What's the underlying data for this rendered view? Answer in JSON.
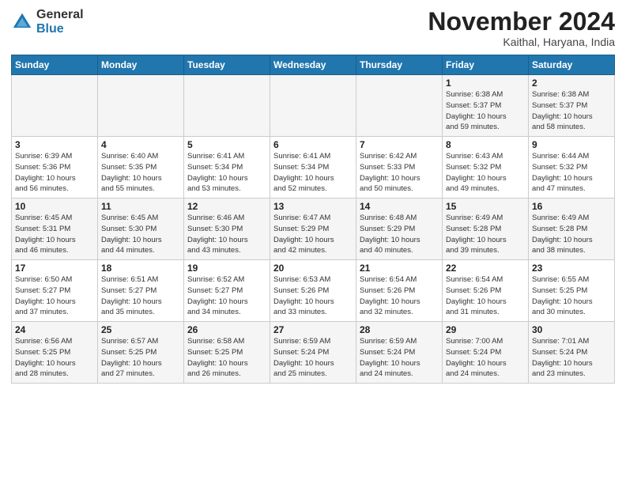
{
  "logo": {
    "line1": "General",
    "line2": "Blue"
  },
  "title": "November 2024",
  "location": "Kaithal, Haryana, India",
  "weekdays": [
    "Sunday",
    "Monday",
    "Tuesday",
    "Wednesday",
    "Thursday",
    "Friday",
    "Saturday"
  ],
  "weeks": [
    [
      {
        "day": "",
        "info": ""
      },
      {
        "day": "",
        "info": ""
      },
      {
        "day": "",
        "info": ""
      },
      {
        "day": "",
        "info": ""
      },
      {
        "day": "",
        "info": ""
      },
      {
        "day": "1",
        "info": "Sunrise: 6:38 AM\nSunset: 5:37 PM\nDaylight: 10 hours\nand 59 minutes."
      },
      {
        "day": "2",
        "info": "Sunrise: 6:38 AM\nSunset: 5:37 PM\nDaylight: 10 hours\nand 58 minutes."
      }
    ],
    [
      {
        "day": "3",
        "info": "Sunrise: 6:39 AM\nSunset: 5:36 PM\nDaylight: 10 hours\nand 56 minutes."
      },
      {
        "day": "4",
        "info": "Sunrise: 6:40 AM\nSunset: 5:35 PM\nDaylight: 10 hours\nand 55 minutes."
      },
      {
        "day": "5",
        "info": "Sunrise: 6:41 AM\nSunset: 5:34 PM\nDaylight: 10 hours\nand 53 minutes."
      },
      {
        "day": "6",
        "info": "Sunrise: 6:41 AM\nSunset: 5:34 PM\nDaylight: 10 hours\nand 52 minutes."
      },
      {
        "day": "7",
        "info": "Sunrise: 6:42 AM\nSunset: 5:33 PM\nDaylight: 10 hours\nand 50 minutes."
      },
      {
        "day": "8",
        "info": "Sunrise: 6:43 AM\nSunset: 5:32 PM\nDaylight: 10 hours\nand 49 minutes."
      },
      {
        "day": "9",
        "info": "Sunrise: 6:44 AM\nSunset: 5:32 PM\nDaylight: 10 hours\nand 47 minutes."
      }
    ],
    [
      {
        "day": "10",
        "info": "Sunrise: 6:45 AM\nSunset: 5:31 PM\nDaylight: 10 hours\nand 46 minutes."
      },
      {
        "day": "11",
        "info": "Sunrise: 6:45 AM\nSunset: 5:30 PM\nDaylight: 10 hours\nand 44 minutes."
      },
      {
        "day": "12",
        "info": "Sunrise: 6:46 AM\nSunset: 5:30 PM\nDaylight: 10 hours\nand 43 minutes."
      },
      {
        "day": "13",
        "info": "Sunrise: 6:47 AM\nSunset: 5:29 PM\nDaylight: 10 hours\nand 42 minutes."
      },
      {
        "day": "14",
        "info": "Sunrise: 6:48 AM\nSunset: 5:29 PM\nDaylight: 10 hours\nand 40 minutes."
      },
      {
        "day": "15",
        "info": "Sunrise: 6:49 AM\nSunset: 5:28 PM\nDaylight: 10 hours\nand 39 minutes."
      },
      {
        "day": "16",
        "info": "Sunrise: 6:49 AM\nSunset: 5:28 PM\nDaylight: 10 hours\nand 38 minutes."
      }
    ],
    [
      {
        "day": "17",
        "info": "Sunrise: 6:50 AM\nSunset: 5:27 PM\nDaylight: 10 hours\nand 37 minutes."
      },
      {
        "day": "18",
        "info": "Sunrise: 6:51 AM\nSunset: 5:27 PM\nDaylight: 10 hours\nand 35 minutes."
      },
      {
        "day": "19",
        "info": "Sunrise: 6:52 AM\nSunset: 5:27 PM\nDaylight: 10 hours\nand 34 minutes."
      },
      {
        "day": "20",
        "info": "Sunrise: 6:53 AM\nSunset: 5:26 PM\nDaylight: 10 hours\nand 33 minutes."
      },
      {
        "day": "21",
        "info": "Sunrise: 6:54 AM\nSunset: 5:26 PM\nDaylight: 10 hours\nand 32 minutes."
      },
      {
        "day": "22",
        "info": "Sunrise: 6:54 AM\nSunset: 5:26 PM\nDaylight: 10 hours\nand 31 minutes."
      },
      {
        "day": "23",
        "info": "Sunrise: 6:55 AM\nSunset: 5:25 PM\nDaylight: 10 hours\nand 30 minutes."
      }
    ],
    [
      {
        "day": "24",
        "info": "Sunrise: 6:56 AM\nSunset: 5:25 PM\nDaylight: 10 hours\nand 28 minutes."
      },
      {
        "day": "25",
        "info": "Sunrise: 6:57 AM\nSunset: 5:25 PM\nDaylight: 10 hours\nand 27 minutes."
      },
      {
        "day": "26",
        "info": "Sunrise: 6:58 AM\nSunset: 5:25 PM\nDaylight: 10 hours\nand 26 minutes."
      },
      {
        "day": "27",
        "info": "Sunrise: 6:59 AM\nSunset: 5:24 PM\nDaylight: 10 hours\nand 25 minutes."
      },
      {
        "day": "28",
        "info": "Sunrise: 6:59 AM\nSunset: 5:24 PM\nDaylight: 10 hours\nand 24 minutes."
      },
      {
        "day": "29",
        "info": "Sunrise: 7:00 AM\nSunset: 5:24 PM\nDaylight: 10 hours\nand 24 minutes."
      },
      {
        "day": "30",
        "info": "Sunrise: 7:01 AM\nSunset: 5:24 PM\nDaylight: 10 hours\nand 23 minutes."
      }
    ]
  ]
}
